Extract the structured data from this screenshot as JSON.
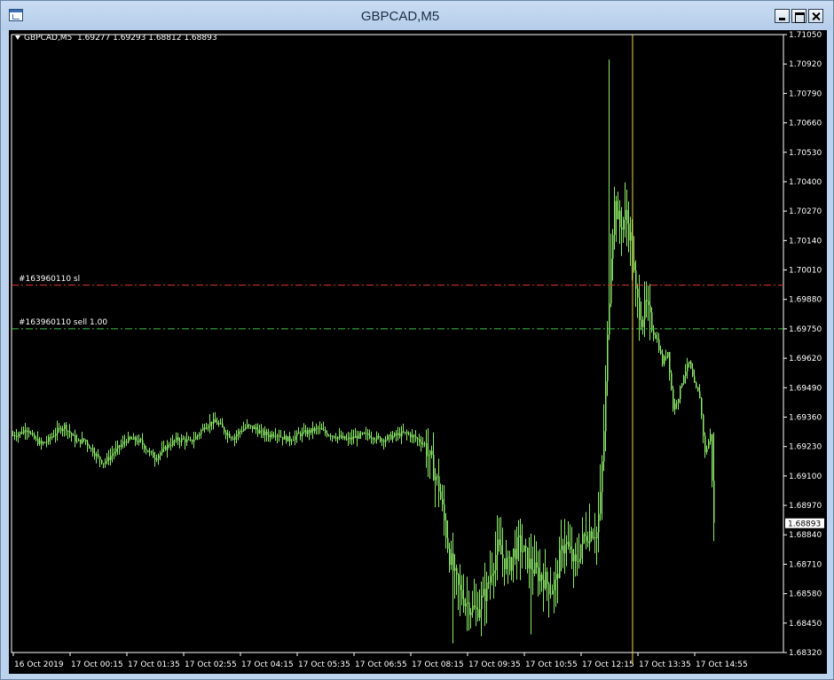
{
  "window": {
    "title": "GBPCAD,M5",
    "icons": {
      "app": "chart-window-icon",
      "minimize": "minimize-icon",
      "maximize": "maximize-icon",
      "close": "close-icon"
    }
  },
  "chart_info": {
    "symbol_timeframe": "GBPCAD,M5",
    "open": "1.69277",
    "high": "1.69293",
    "low": "1.68812",
    "close": "1.68893"
  },
  "order_lines": [
    {
      "label": "#163960110 sl",
      "price": 1.69943,
      "color": "#E03A2A"
    },
    {
      "label": "#163960110 sell 1.00",
      "price": 1.6975,
      "color": "#3FBF45"
    }
  ],
  "colors": {
    "background": "#000000",
    "candle": "#8BEA67",
    "vline": "#F0D24A",
    "axis": "#FFFFFF"
  },
  "chart_data": {
    "type": "candlestick",
    "symbol": "GBPCAD",
    "timeframe": "M5",
    "ylim": [
      1.6832,
      1.7105
    ],
    "y_ticks": [
      "1.71050",
      "1.70920",
      "1.70790",
      "1.70660",
      "1.70530",
      "1.70400",
      "1.70270",
      "1.70140",
      "1.70010",
      "1.69880",
      "1.69750",
      "1.69620",
      "1.69490",
      "1.69360",
      "1.69230",
      "1.69100",
      "1.68970",
      "1.68840",
      "1.68710",
      "1.68580",
      "1.68450",
      "1.68320"
    ],
    "x_ticks": [
      "16 Oct 2019",
      "17 Oct 00:15",
      "17 Oct 01:35",
      "17 Oct 02:55",
      "17 Oct 04:15",
      "17 Oct 05:35",
      "17 Oct 06:55",
      "17 Oct 08:15",
      "17 Oct 09:35",
      "17 Oct 10:55",
      "17 Oct 12:15",
      "17 Oct 13:35",
      "17 Oct 14:55"
    ],
    "current_price": "1.68893",
    "vertical_line_time": "17 Oct 12:40",
    "close_path": [
      [
        0,
        1.6928
      ],
      [
        4,
        1.6929
      ],
      [
        8,
        1.6931
      ],
      [
        11,
        1.6927
      ],
      [
        16,
        1.6924
      ],
      [
        20,
        1.6926
      ],
      [
        25,
        1.693
      ],
      [
        29,
        1.6932
      ],
      [
        33,
        1.6928
      ],
      [
        36,
        1.6925
      ],
      [
        40,
        1.6926
      ],
      [
        44,
        1.6922
      ],
      [
        48,
        1.6918
      ],
      [
        51,
        1.6916
      ],
      [
        54,
        1.6918
      ],
      [
        56,
        1.692
      ],
      [
        60,
        1.6923
      ],
      [
        64,
        1.6926
      ],
      [
        68,
        1.6926
      ],
      [
        72,
        1.6925
      ],
      [
        76,
        1.6921
      ],
      [
        80,
        1.6918
      ],
      [
        84,
        1.6921
      ],
      [
        88,
        1.6924
      ],
      [
        92,
        1.6926
      ],
      [
        96,
        1.6926
      ],
      [
        100,
        1.6925
      ],
      [
        104,
        1.6928
      ],
      [
        108,
        1.6932
      ],
      [
        112,
        1.6934
      ],
      [
        116,
        1.6933
      ],
      [
        120,
        1.6929
      ],
      [
        124,
        1.6927
      ],
      [
        128,
        1.693
      ],
      [
        132,
        1.6932
      ],
      [
        136,
        1.6931
      ],
      [
        140,
        1.6929
      ],
      [
        144,
        1.6928
      ],
      [
        148,
        1.6929
      ],
      [
        152,
        1.6927
      ],
      [
        156,
        1.6926
      ],
      [
        160,
        1.6928
      ],
      [
        164,
        1.6929
      ],
      [
        168,
        1.693
      ],
      [
        172,
        1.6931
      ],
      [
        176,
        1.6929
      ],
      [
        180,
        1.6928
      ],
      [
        184,
        1.6927
      ],
      [
        188,
        1.6926
      ],
      [
        192,
        1.6927
      ],
      [
        196,
        1.6928
      ],
      [
        200,
        1.6928
      ],
      [
        204,
        1.6927
      ],
      [
        208,
        1.6926
      ],
      [
        212,
        1.6927
      ],
      [
        216,
        1.6928
      ],
      [
        220,
        1.6929
      ],
      [
        224,
        1.6928
      ],
      [
        228,
        1.6926
      ],
      [
        232,
        1.6924
      ],
      [
        236,
        1.6915
      ],
      [
        240,
        1.6905
      ],
      [
        243,
        1.689
      ],
      [
        246,
        1.6875
      ],
      [
        249,
        1.6865
      ],
      [
        252,
        1.6858
      ],
      [
        255,
        1.6855
      ],
      [
        258,
        1.6852
      ],
      [
        261,
        1.685
      ],
      [
        264,
        1.6855
      ],
      [
        267,
        1.686
      ],
      [
        270,
        1.687
      ],
      [
        273,
        1.6878
      ],
      [
        276,
        1.6874
      ],
      [
        279,
        1.687
      ],
      [
        282,
        1.6876
      ],
      [
        285,
        1.688
      ],
      [
        288,
        1.6876
      ],
      [
        291,
        1.6871
      ],
      [
        294,
        1.6868
      ],
      [
        297,
        1.6866
      ],
      [
        300,
        1.6864
      ],
      [
        303,
        1.686
      ],
      [
        306,
        1.6864
      ],
      [
        308,
        1.6873
      ],
      [
        311,
        1.6882
      ],
      [
        314,
        1.6875
      ],
      [
        317,
        1.687
      ],
      [
        320,
        1.688
      ],
      [
        323,
        1.6884
      ],
      [
        326,
        1.6886
      ],
      [
        329,
        1.6885
      ],
      [
        331,
        1.69
      ],
      [
        333,
        1.693
      ],
      [
        335,
        1.697
      ],
      [
        337,
        1.701
      ],
      [
        339,
        1.703
      ],
      [
        342,
        1.702
      ],
      [
        345,
        1.7025
      ],
      [
        348,
        1.7015
      ],
      [
        351,
        1.699
      ],
      [
        354,
        1.698
      ],
      [
        357,
        1.6985
      ],
      [
        360,
        1.6975
      ],
      [
        363,
        1.697
      ],
      [
        366,
        1.696
      ],
      [
        369,
        1.6965
      ],
      [
        372,
        1.694
      ],
      [
        375,
        1.6945
      ],
      [
        378,
        1.6955
      ],
      [
        381,
        1.696
      ],
      [
        384,
        1.695
      ],
      [
        387,
        1.6945
      ],
      [
        390,
        1.692
      ],
      [
        393,
        1.6928
      ],
      [
        395,
        1.6889
      ]
    ]
  }
}
